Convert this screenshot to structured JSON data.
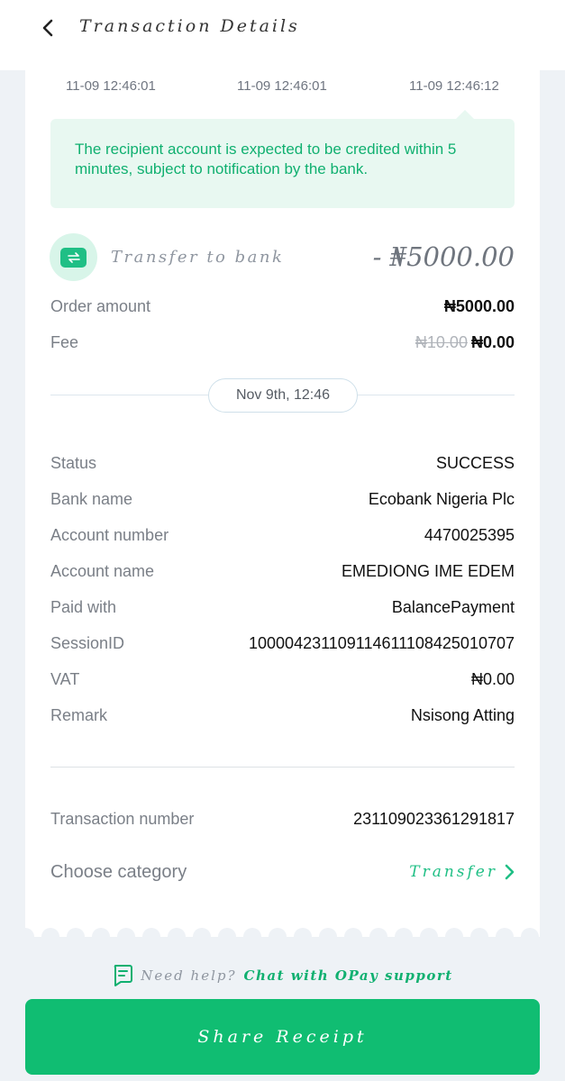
{
  "header": {
    "title": "Transaction Details"
  },
  "timeline": [
    "11-09 12:46:01",
    "11-09 12:46:01",
    "11-09 12:46:12"
  ],
  "notice": "The recipient account is expected to be credited within 5 minutes, subject to notification by the bank.",
  "summary": {
    "type": "Transfer to bank",
    "amount": "- ₦5000.00",
    "order_amount_label": "Order amount",
    "order_amount_value": "₦5000.00",
    "fee_label": "Fee",
    "fee_original": "₦10.00",
    "fee_value": "₦0.00"
  },
  "date_pill": "Nov 9th, 12:46",
  "details": [
    {
      "label": "Status",
      "value": "SUCCESS"
    },
    {
      "label": "Bank name",
      "value": "Ecobank Nigeria Plc"
    },
    {
      "label": "Account number",
      "value": "4470025395"
    },
    {
      "label": "Account name",
      "value": "EMEDIONG IME EDEM"
    },
    {
      "label": "Paid with",
      "value": "BalancePayment"
    },
    {
      "label": "SessionID",
      "value": "100004231109114611108425010707"
    },
    {
      "label": "VAT",
      "value": "₦0.00"
    },
    {
      "label": "Remark",
      "value": "Nsisong Atting"
    }
  ],
  "transaction": {
    "label": "Transaction number",
    "value": "231109023361291817"
  },
  "category": {
    "label": "Choose category",
    "value": "Transfer"
  },
  "help": {
    "text": "Need help?",
    "link": "Chat with OPay support"
  },
  "share_button": "Share Receipt",
  "colors": {
    "accent": "#10bd72",
    "notice_bg": "#e8f8f1",
    "page_bg": "#eef2f6"
  }
}
